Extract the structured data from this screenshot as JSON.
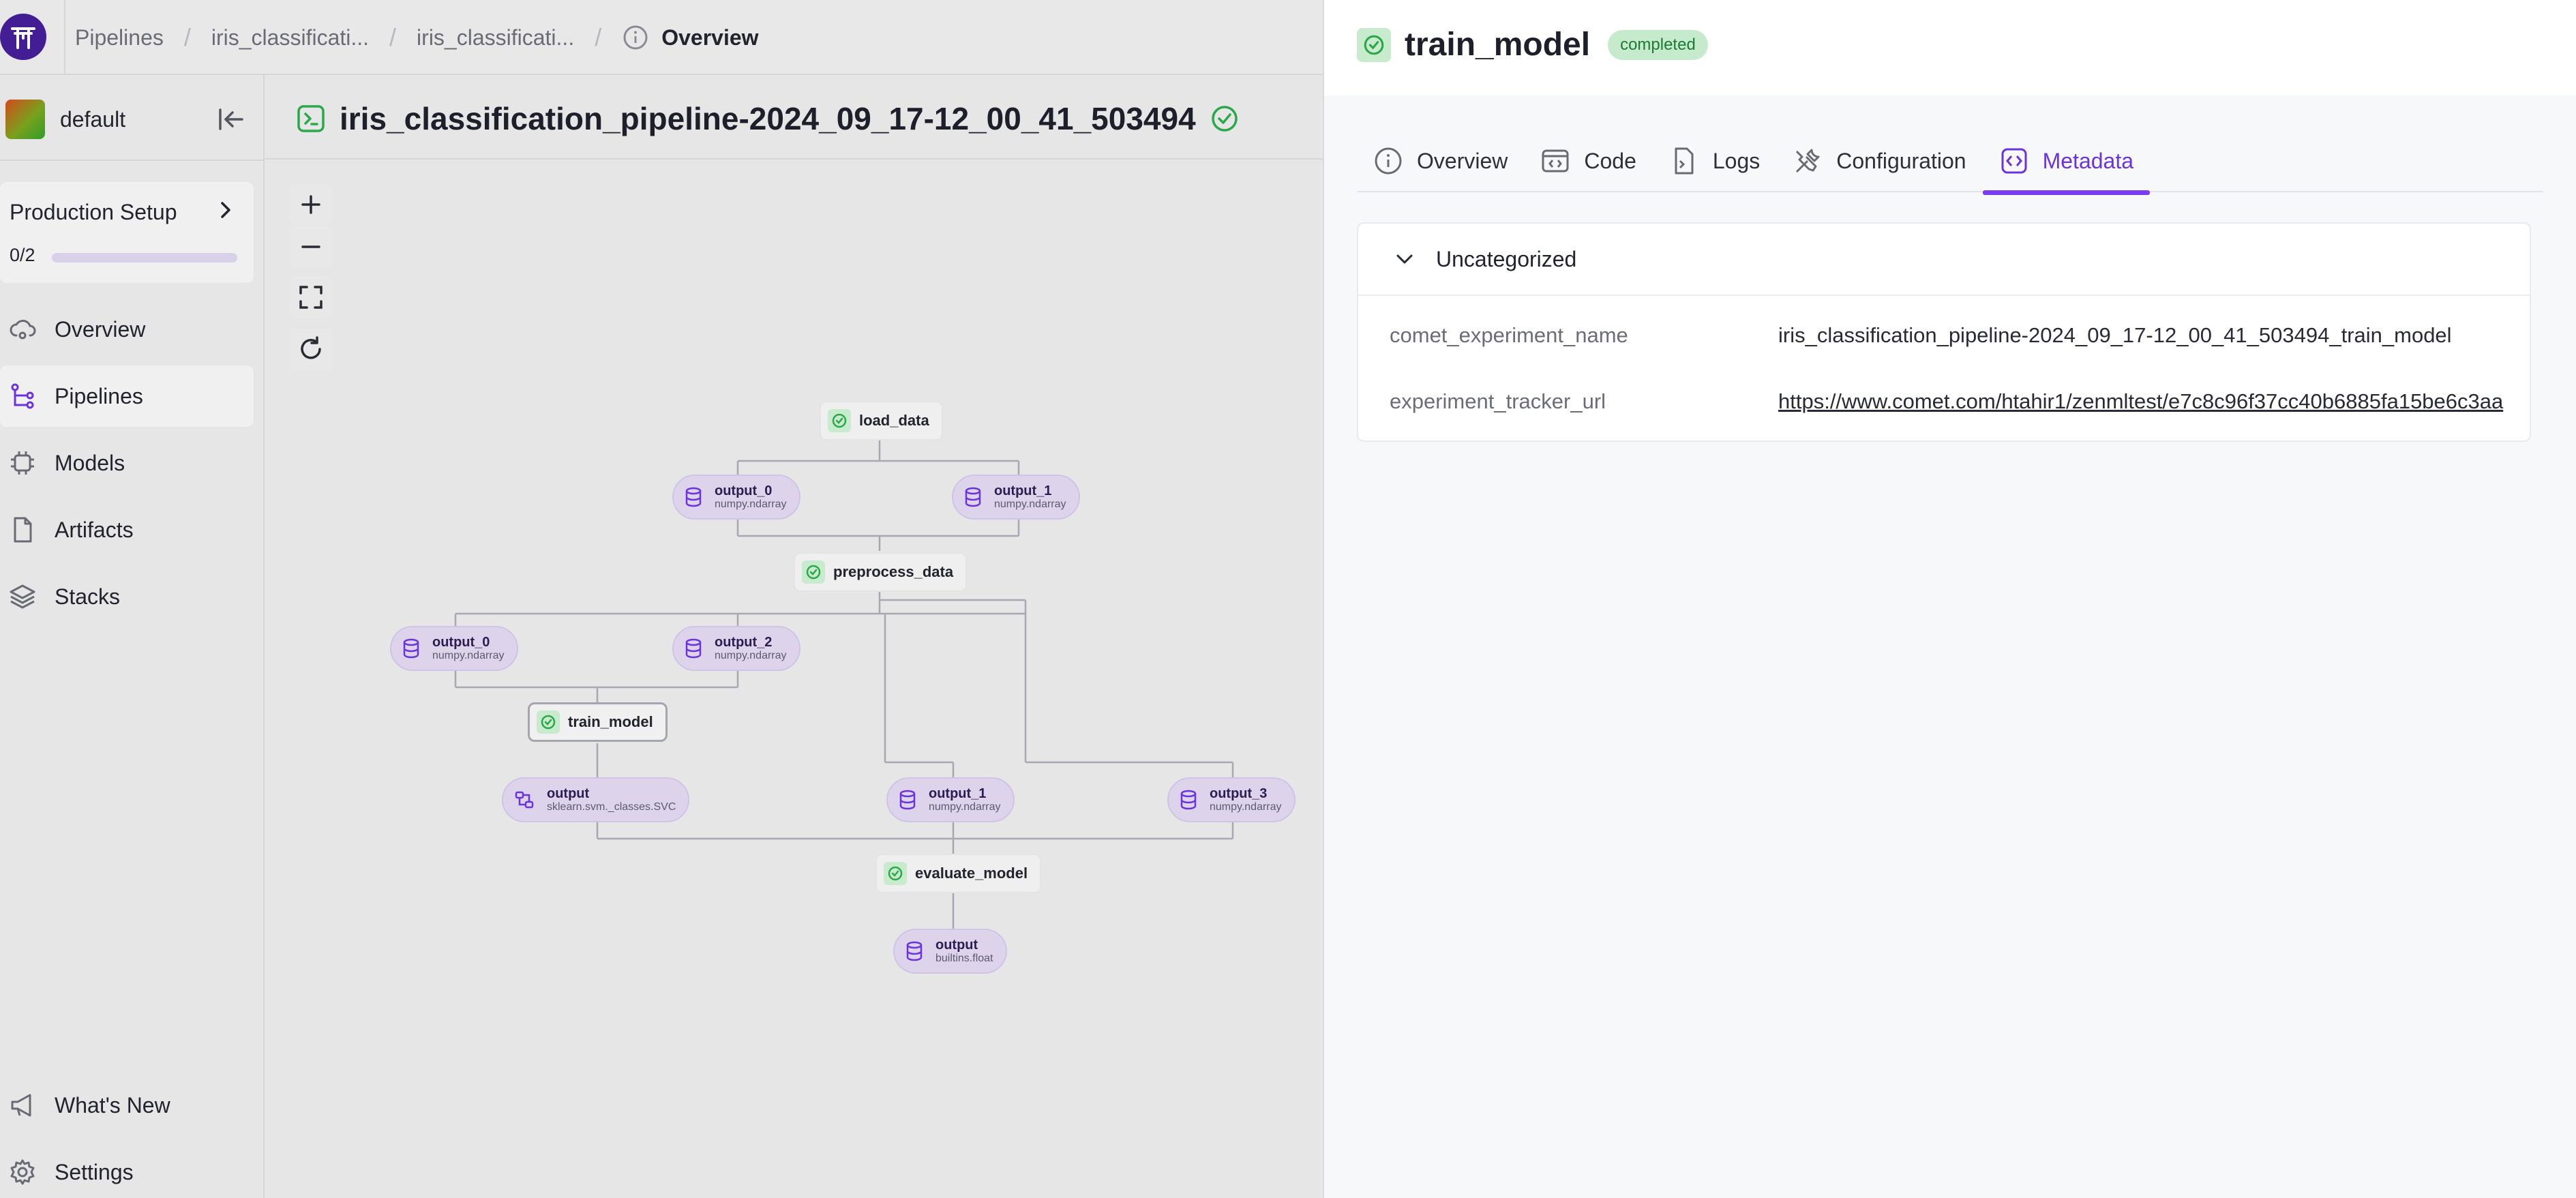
{
  "breadcrumbs": {
    "items": [
      "Pipelines",
      "iris_classificati...",
      "iris_classificati..."
    ],
    "current": "Overview"
  },
  "sidebar": {
    "workspace": "default",
    "production_setup": {
      "title": "Production Setup",
      "count": "0/2",
      "progress": 0.0
    },
    "items": [
      {
        "label": "Overview",
        "icon": "cloud-icon"
      },
      {
        "label": "Pipelines",
        "icon": "pipeline-icon",
        "active": true
      },
      {
        "label": "Models",
        "icon": "chip-icon"
      },
      {
        "label": "Artifacts",
        "icon": "file-icon"
      },
      {
        "label": "Stacks",
        "icon": "layers-icon"
      }
    ],
    "bottom_items": [
      {
        "label": "What's New",
        "icon": "megaphone-icon"
      },
      {
        "label": "Settings",
        "icon": "gear-icon"
      }
    ]
  },
  "run": {
    "title": "iris_classification_pipeline-2024_09_17-12_00_41_503494"
  },
  "dag": {
    "steps": {
      "load_data": "load_data",
      "preprocess_data": "preprocess_data",
      "train_model": "train_model",
      "evaluate_model": "evaluate_model"
    },
    "artifacts": {
      "ld_out0": {
        "name": "output_0",
        "type": "numpy.ndarray"
      },
      "ld_out1": {
        "name": "output_1",
        "type": "numpy.ndarray"
      },
      "pp_out0": {
        "name": "output_0",
        "type": "numpy.ndarray"
      },
      "pp_out2": {
        "name": "output_2",
        "type": "numpy.ndarray"
      },
      "pp_out1": {
        "name": "output_1",
        "type": "numpy.ndarray"
      },
      "pp_out3": {
        "name": "output_3",
        "type": "numpy.ndarray"
      },
      "tm_out": {
        "name": "output",
        "type": "sklearn.svm._classes.SVC"
      },
      "em_out": {
        "name": "output",
        "type": "builtins.float"
      }
    }
  },
  "panel": {
    "title": "train_model",
    "status": "completed",
    "tabs": [
      "Overview",
      "Code",
      "Logs",
      "Configuration",
      "Metadata"
    ],
    "active_tab": "Metadata",
    "section": "Uncategorized",
    "rows": [
      {
        "key": "comet_experiment_name",
        "value": "iris_classification_pipeline-2024_09_17-12_00_41_503494_train_model"
      },
      {
        "key": "experiment_tracker_url",
        "value": "https://www.comet.com/htahir1/zenmltest/e7c8c96f37cc40b6885fa15be6c3aa"
      }
    ]
  },
  "colors": {
    "accent": "#7a3ef0",
    "success": "#2aa84a",
    "brand": "#431d93"
  }
}
